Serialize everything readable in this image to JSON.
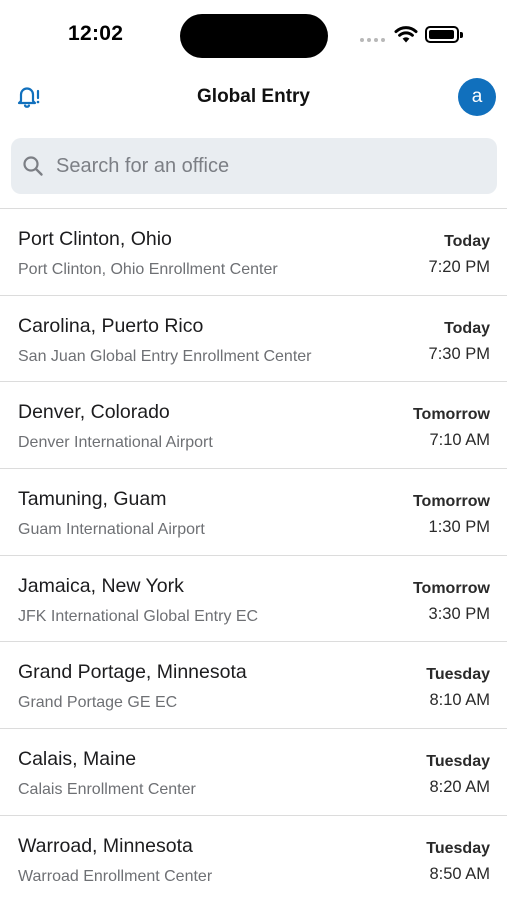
{
  "status_bar": {
    "time": "12:02"
  },
  "header": {
    "title": "Global Entry",
    "avatar_initial": "a",
    "accent_color": "#1170bd"
  },
  "search": {
    "placeholder": "Search for an office"
  },
  "offices": [
    {
      "city": "Port Clinton, Ohio",
      "center": "Port Clinton, Ohio Enrollment Center",
      "day": "Today",
      "time": "7:20 PM"
    },
    {
      "city": "Carolina, Puerto Rico",
      "center": "San Juan Global Entry Enrollment Center",
      "day": "Today",
      "time": "7:30 PM"
    },
    {
      "city": "Denver, Colorado",
      "center": "Denver International Airport",
      "day": "Tomorrow",
      "time": "7:10 AM"
    },
    {
      "city": "Tamuning, Guam",
      "center": "Guam International Airport",
      "day": "Tomorrow",
      "time": "1:30 PM"
    },
    {
      "city": "Jamaica, New York",
      "center": "JFK International Global Entry EC",
      "day": "Tomorrow",
      "time": "3:30 PM"
    },
    {
      "city": "Grand Portage, Minnesota",
      "center": "Grand Portage GE EC",
      "day": "Tuesday",
      "time": "8:10 AM"
    },
    {
      "city": "Calais, Maine",
      "center": "Calais Enrollment Center",
      "day": "Tuesday",
      "time": "8:20 AM"
    },
    {
      "city": "Warroad, Minnesota",
      "center": "Warroad Enrollment Center",
      "day": "Tuesday",
      "time": "8:50 AM"
    }
  ],
  "icons": {
    "notifications": "bell-alert-icon",
    "search": "magnifier-icon",
    "wifi": "wifi-icon",
    "battery": "battery-icon",
    "signal": "cellular-signal-icon"
  }
}
